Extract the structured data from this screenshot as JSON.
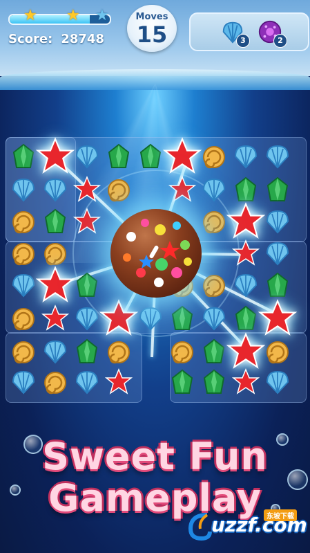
{
  "hud": {
    "score_label": "Score:",
    "score_value": "28748",
    "progress_fraction": 0.8,
    "stars_earned": 2,
    "stars_total": 3,
    "moves_label": "Moves",
    "moves_value": "15"
  },
  "goals": [
    {
      "icon": "blue-shell-icon",
      "count": "3"
    },
    {
      "icon": "purple-urchin-icon",
      "count": "2"
    }
  ],
  "title": {
    "line1": "Sweet Fun",
    "line2": "Gameplay"
  },
  "watermark": {
    "text": "uzzf.com",
    "badge": "东坡下载"
  },
  "colors": {
    "red_star": "#e8262c",
    "blue_shell": "#6fc4ee",
    "green_crystal": "#27a84a",
    "gold_snail": "#f2b84a",
    "title_pink": "#ffd6e3"
  }
}
